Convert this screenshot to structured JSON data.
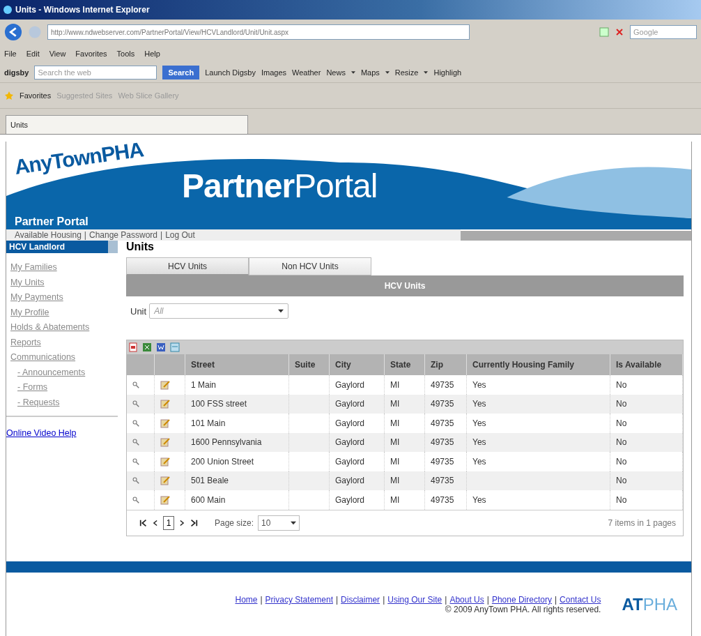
{
  "browser": {
    "title": "Units - Windows Internet Explorer",
    "address": "http://www.ndwebserver.com/PartnerPortal/View/HCVLandlord/Unit/Unit.aspx",
    "search_engine": "Google",
    "menu": [
      "File",
      "Edit",
      "View",
      "Favorites",
      "Tools",
      "Help"
    ],
    "toolbar": {
      "brand": "digsby",
      "search_placeholder": "Search the web",
      "search_button": "Search",
      "items": [
        {
          "label": "Launch Digsby",
          "dropdown": false
        },
        {
          "label": "Images",
          "dropdown": false
        },
        {
          "label": "Weather",
          "dropdown": false
        },
        {
          "label": "News",
          "dropdown": true
        },
        {
          "label": "Maps",
          "dropdown": true
        },
        {
          "label": "Resize",
          "dropdown": true
        },
        {
          "label": "Highligh",
          "dropdown": false
        }
      ]
    },
    "favorites": {
      "label": "Favorites",
      "items": [
        "Suggested Sites",
        "Web Slice Gallery"
      ]
    },
    "tab": "Units"
  },
  "header": {
    "logo": "AnyTownPHA",
    "title_bold": "Partner",
    "title_light": "Portal",
    "site_name": "Partner Portal",
    "links": [
      "Available Housing",
      "Change Password",
      "Log Out"
    ],
    "link_separator": "|"
  },
  "sidebar": {
    "heading": "HCV Landlord",
    "items": [
      {
        "label": "My Families"
      },
      {
        "label": "My Units"
      },
      {
        "label": "My Payments"
      },
      {
        "label": "My Profile"
      },
      {
        "label": "Holds & Abatements"
      },
      {
        "label": "Reports"
      },
      {
        "label": "Communications",
        "children": [
          {
            "label": "- Announcements"
          },
          {
            "label": "- Forms"
          },
          {
            "label": "- Requests"
          }
        ]
      }
    ],
    "help_link": "Online Video Help"
  },
  "main": {
    "title": "Units",
    "tabs": [
      {
        "label": "HCV Units",
        "selected": true
      },
      {
        "label": "Non HCV Units",
        "selected": false
      }
    ],
    "panel_title": "HCV Units",
    "filter": {
      "label": "Unit",
      "placeholder": "All"
    },
    "table": {
      "columns": [
        "Street",
        "Suite",
        "City",
        "State",
        "Zip",
        "Currently Housing Family",
        "Is Available"
      ],
      "rows": [
        [
          "1 Main",
          "",
          "Gaylord",
          "MI",
          "49735",
          "Yes",
          "No"
        ],
        [
          "100 FSS street",
          "",
          "Gaylord",
          "MI",
          "49735",
          "Yes",
          "No"
        ],
        [
          "101 Main",
          "",
          "Gaylord",
          "MI",
          "49735",
          "Yes",
          "No"
        ],
        [
          "1600 Pennsylvania",
          "",
          "Gaylord",
          "MI",
          "49735",
          "Yes",
          "No"
        ],
        [
          "200 Union Street",
          "",
          "Gaylord",
          "MI",
          "49735",
          "Yes",
          "No"
        ],
        [
          "501 Beale",
          "",
          "Gaylord",
          "MI",
          "49735",
          "",
          "No"
        ],
        [
          "600 Main",
          "",
          "Gaylord",
          "MI",
          "49735",
          "Yes",
          "No"
        ]
      ]
    },
    "pager": {
      "page": "1",
      "page_size_label": "Page size:",
      "page_size": "10",
      "summary": "7 items in 1 pages"
    }
  },
  "footer": {
    "links": [
      "Home",
      "Privacy Statement",
      "Disclaimer",
      "Using Our Site",
      "About Us",
      "Phone Directory",
      "Contact Us"
    ],
    "link_separator": "|",
    "copyright": "© 2009 AnyTown PHA. All rights reserved.",
    "logo_bold": "AT",
    "logo_light": "PHA"
  }
}
